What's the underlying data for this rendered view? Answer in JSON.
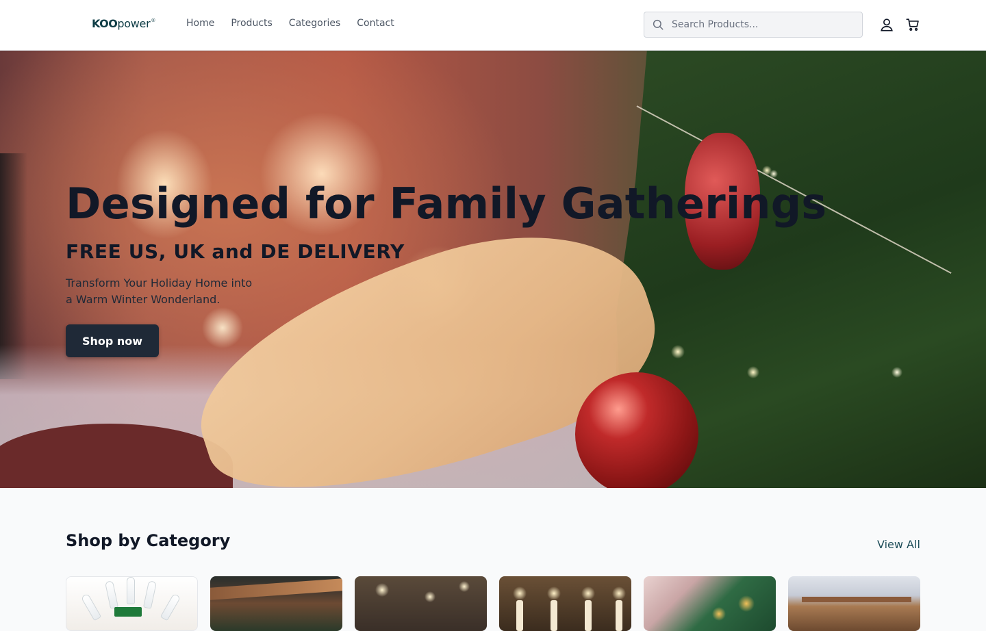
{
  "header": {
    "logo": {
      "koo": "KOO",
      "power": "power",
      "mark": "®"
    },
    "nav": [
      "Home",
      "Products",
      "Categories",
      "Contact"
    ],
    "search": {
      "placeholder": "Search Products...",
      "value": ""
    }
  },
  "hero": {
    "title": "Designed for Family Gatherings",
    "subtitle": "FREE US, UK and DE DELIVERY",
    "description": "Transform Your Holiday Home into a Warm Winter Wonderland.",
    "cta": "Shop now"
  },
  "categories": {
    "title": "Shop by Category",
    "view_all": "View All"
  },
  "icons": {
    "search": "search-icon",
    "user": "user-icon",
    "cart": "cart-icon"
  },
  "colors": {
    "primary_dark": "#1f2937",
    "brand": "#0f3d46",
    "link": "#1f4e5a"
  }
}
